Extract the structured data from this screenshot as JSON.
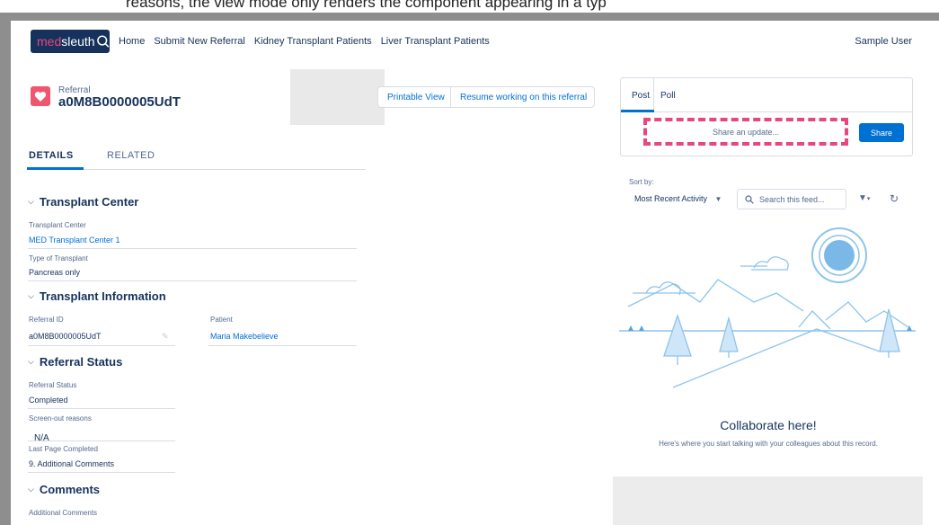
{
  "top_strip_text": "reasons, the view mode only renders the component appearing in a typ",
  "app": {
    "logo_part1": "med",
    "logo_part2": "sleuth",
    "nav": [
      "Home",
      "Submit New Referral",
      "Kidney Transplant Patients",
      "Liver Transplant Patients"
    ],
    "user": "Sample User"
  },
  "record": {
    "type": "Referral",
    "name": "a0M8B0000005UdT",
    "buttons": {
      "printable": "Printable View",
      "resume": "Resume working on this referral"
    }
  },
  "tabs": {
    "details": "DETAILS",
    "related": "RELATED"
  },
  "sections": {
    "transplant_center": {
      "title": "Transplant Center",
      "center_label": "Transplant Center",
      "center_value": "MED Transplant Center 1",
      "type_label": "Type of Transplant",
      "type_value": "Pancreas only"
    },
    "transplant_info": {
      "title": "Transplant Information",
      "referral_id_label": "Referral ID",
      "referral_id_value": "a0M8B0000005UdT",
      "patient_label": "Patient",
      "patient_value": "Maria Makebelieve"
    },
    "referral_status": {
      "title": "Referral Status",
      "status_label": "Referral Status",
      "status_value": "Completed",
      "screenout_label": "Screen-out reasons",
      "screenout_value": "N/A",
      "last_page_label": "Last Page Completed",
      "last_page_value": "9. Additional Comments"
    },
    "comments": {
      "title": "Comments",
      "additional_label": "Additional Comments"
    }
  },
  "publisher": {
    "tab_post": "Post",
    "tab_poll": "Poll",
    "share_placeholder": "Share an update...",
    "share_button": "Share"
  },
  "feed": {
    "sort_label": "Sort by:",
    "sort_value": "Most Recent Activity",
    "search_placeholder": "Search this feed...",
    "empty_title": "Collaborate here!",
    "empty_sub": "Here's where you start talking with your colleagues about this record."
  },
  "colors": {
    "brand_navy": "#16325c",
    "brand_pink": "#e8467c",
    "link_blue": "#0070d2",
    "record_icon": "#f0566f"
  }
}
